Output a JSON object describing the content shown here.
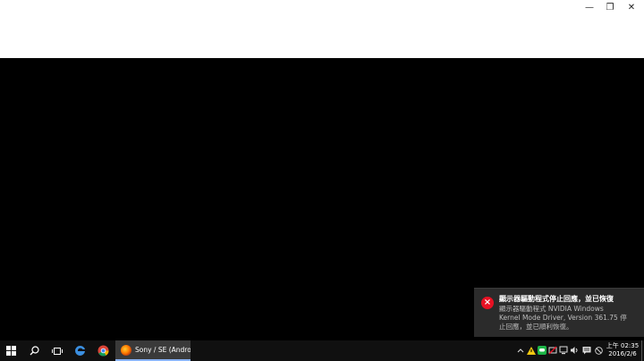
{
  "window": {
    "controls": {
      "minimize": "—",
      "restore": "❐",
      "close": "✕"
    }
  },
  "notification": {
    "icon": "error-icon",
    "title": "顯示器驅動程式停止回應，並已恢復",
    "body_line1": "顯示器驅動程式 NVIDIA Windows",
    "body_line2": "Kernel Mode Driver, Version 361.75  停",
    "body_line3": "止回應，並已順利恢復。"
  },
  "taskbar": {
    "start_icon": "windows-start-icon",
    "search_icon": "search-icon",
    "task_view_icon": "task-view-icon",
    "pinned": [
      "edge-icon",
      "chrome-icon"
    ],
    "running_app": {
      "icon": "firefox-icon",
      "label": "Sony / SE (Androi..."
    },
    "tray_icons": [
      "chevron-up-icon",
      "warning-icon",
      "line-icon",
      "no-wifi-icon",
      "shield-icon",
      "network-icon",
      "volume-icon",
      "ime-icon",
      "action-center-icon",
      "block-icon"
    ],
    "clock": {
      "time": "上午 02:35",
      "date": "2016/2/6"
    }
  },
  "colors": {
    "accent": "#8ab4f8",
    "error": "#e81123",
    "taskbar": "#101010",
    "toast": "#2b2b2b"
  }
}
